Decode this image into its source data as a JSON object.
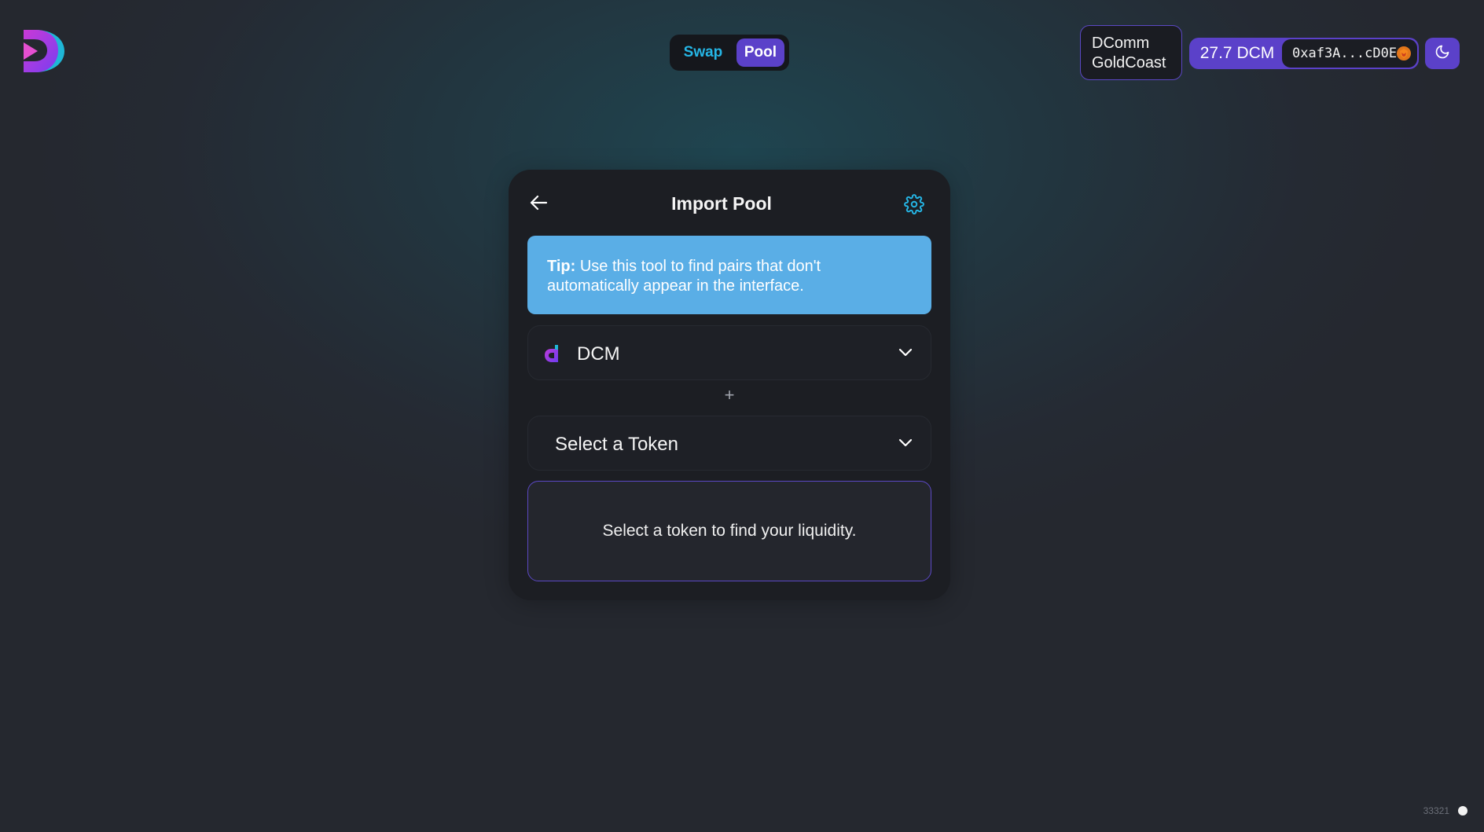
{
  "header": {
    "logo_icon": "dcomm-logo-icon",
    "nav": {
      "swap_label": "Swap",
      "pool_label": "Pool",
      "active": "Pool"
    },
    "network": {
      "line1": "DComm",
      "line2": "GoldCoast"
    },
    "account": {
      "balance": "27.7 DCM",
      "address": "0xaf3A...cD0E",
      "wallet_icon": "metamask-fox-icon"
    },
    "theme_icon": "moon-icon"
  },
  "card": {
    "title": "Import Pool",
    "back_icon": "arrow-left-icon",
    "settings_icon": "gear-icon",
    "tip": {
      "label": "Tip:",
      "text": " Use this tool to find pairs that don't automatically appear in the interface."
    },
    "token_a": {
      "symbol": "DCM",
      "icon": "dcm-token-icon"
    },
    "plus": "+",
    "token_b": {
      "placeholder": "Select a Token"
    },
    "info_message": "Select a token to find your liquidity."
  },
  "footer": {
    "block_number": "33321"
  },
  "colors": {
    "accent": "#5b41c9",
    "swap_text": "#25b6e6",
    "tip_bg": "#5aaee6",
    "card_bg": "#1c1e23",
    "settings_icon": "#25b6e6"
  }
}
